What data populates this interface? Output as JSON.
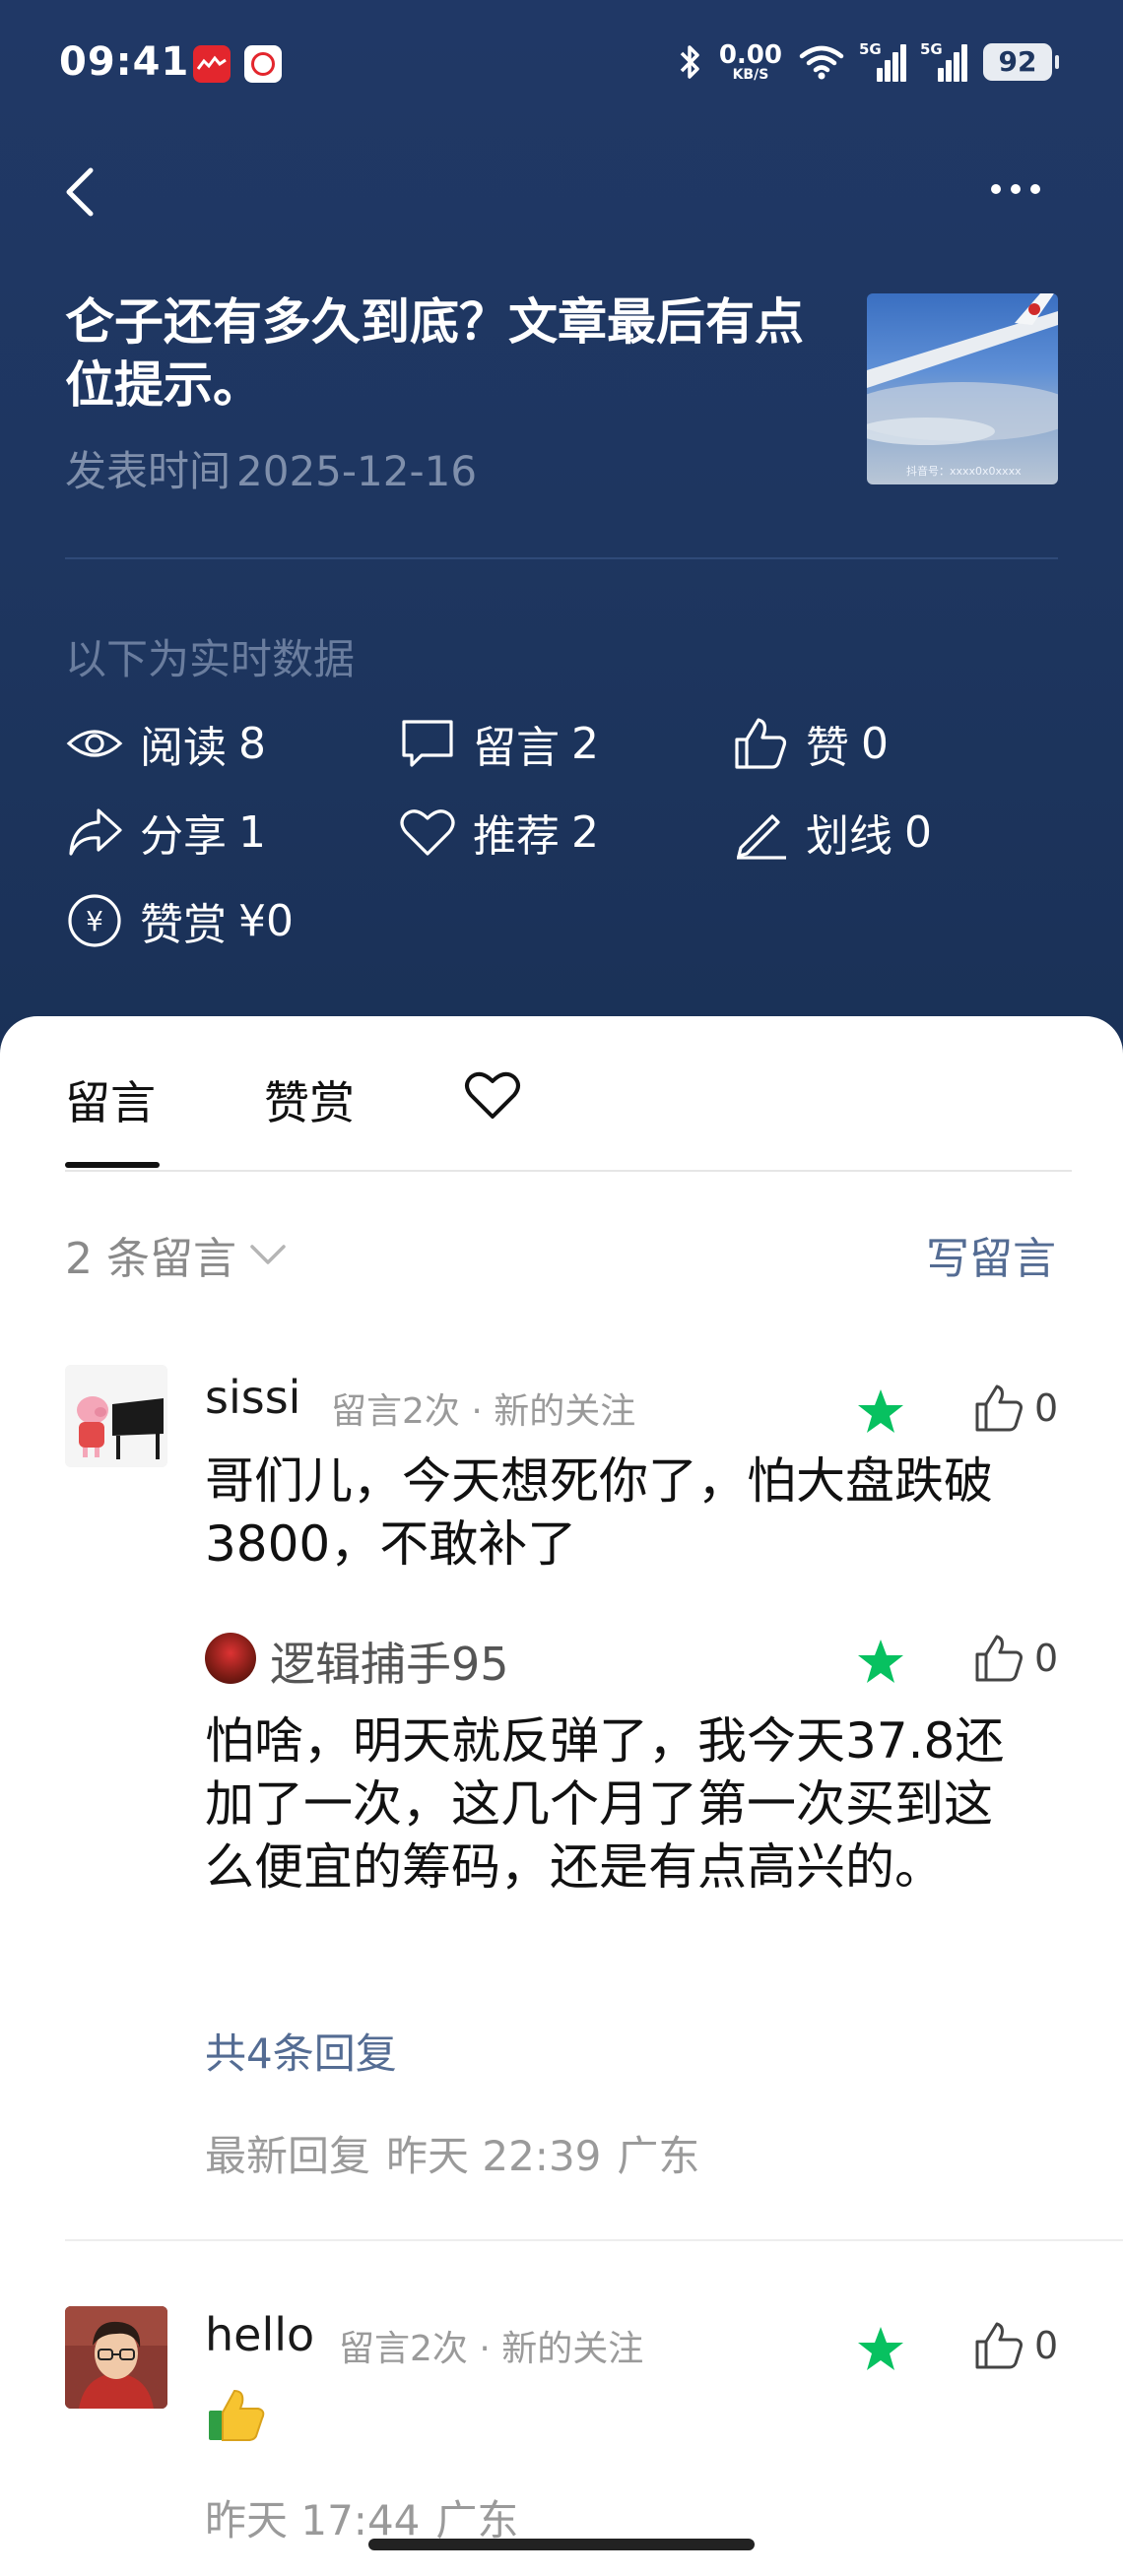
{
  "status_bar": {
    "time": "09:41",
    "speed_value": "0.00",
    "speed_unit": "KB/S",
    "sim1": "5G",
    "sim2": "5G",
    "battery": "92"
  },
  "article": {
    "title": "仑子还有多久到底？文章最后有点位提示。",
    "publish_label": "发表时间",
    "publish_date": "2025-12-16",
    "thumbnail_watermark": "抖音号：xxxx0x0xxxx"
  },
  "realtime": {
    "label": "以下为实时数据",
    "stats": [
      {
        "icon": "eye-icon",
        "label": "阅读",
        "value": "8"
      },
      {
        "icon": "comment-icon",
        "label": "留言",
        "value": "2"
      },
      {
        "icon": "thumbs-up-icon",
        "label": "赞",
        "value": "0"
      },
      {
        "icon": "share-icon",
        "label": "分享",
        "value": "1"
      },
      {
        "icon": "heart-icon",
        "label": "推荐",
        "value": "2"
      },
      {
        "icon": "pen-icon",
        "label": "划线",
        "value": "0"
      },
      {
        "icon": "yen-icon",
        "label": "赞赏",
        "value": "¥0"
      }
    ]
  },
  "tabs": {
    "comments": "留言",
    "rewards": "赞赏",
    "favorites_icon": "heart-icon"
  },
  "comments_header": {
    "count_text": "2 条留言",
    "write_button": "写留言"
  },
  "comments": [
    {
      "name": "sissi",
      "meta": "留言2次 · 新的关注",
      "text": "哥们儿，今天想死你了，怕大盘跌破3800，不敢补了",
      "likes": "0",
      "reply": {
        "name": "逻辑捕手95",
        "text": "怕啥，明天就反弹了，我今天37.8还加了一次，这几个月了第一次买到这么便宜的筹码，还是有点高兴的。",
        "likes": "0"
      },
      "more_replies": "共4条回复",
      "latest_label": "最新回复",
      "latest_time": "昨天 22:39",
      "location": "广东"
    },
    {
      "name": "hello",
      "meta": "留言2次 · 新的关注",
      "likes": "0",
      "time": "昨天 17:44",
      "location": "广东"
    }
  ],
  "colors": {
    "header_bg": "#1e3660",
    "accent_link": "#546c93",
    "star_green": "#07c160"
  }
}
